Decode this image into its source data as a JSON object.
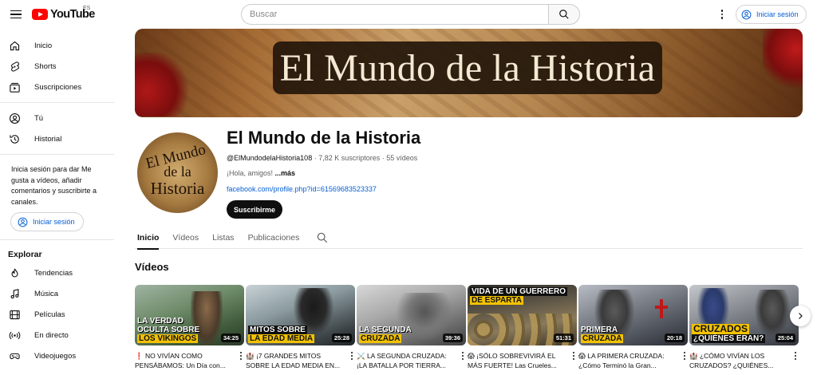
{
  "topbar": {
    "logo_text": "YouTube",
    "region": "ES",
    "search_placeholder": "Buscar",
    "signin_label": "Iniciar sesión"
  },
  "sidebar": {
    "main_items": [
      {
        "label": "Inicio",
        "icon": "home-icon"
      },
      {
        "label": "Shorts",
        "icon": "shorts-icon"
      },
      {
        "label": "Suscripciones",
        "icon": "subscriptions-icon"
      }
    ],
    "you_items": [
      {
        "label": "Tú",
        "icon": "user-icon"
      },
      {
        "label": "Historial",
        "icon": "history-icon"
      }
    ],
    "signin_prompt": "Inicia sesión para dar Me gusta a vídeos, añadir comentarios y suscribirte a canales.",
    "signin_label": "Iniciar sesión",
    "explore_title": "Explorar",
    "explore_items": [
      {
        "label": "Tendencias",
        "icon": "trending-icon"
      },
      {
        "label": "Música",
        "icon": "music-icon"
      },
      {
        "label": "Películas",
        "icon": "movies-icon"
      },
      {
        "label": "En directo",
        "icon": "live-icon"
      },
      {
        "label": "Videojuegos",
        "icon": "gaming-icon"
      }
    ]
  },
  "channel": {
    "banner_title": "El Mundo de la Historia",
    "avatar_lines": [
      "El Mundo",
      "de la",
      "Historia"
    ],
    "name": "El Mundo de la Historia",
    "handle": "@ElMundodelaHistoria108",
    "subscribers": "7,82 K suscriptores",
    "videos_count": "55 vídeos",
    "description": "¡Hola, amigos!",
    "more_label": "...más",
    "link": "facebook.com/profile.php?id=61569683523337",
    "subscribe_label": "Suscribirme"
  },
  "tabs": [
    {
      "label": "Inicio",
      "active": true
    },
    {
      "label": "Vídeos",
      "active": false
    },
    {
      "label": "Listas",
      "active": false
    },
    {
      "label": "Publicaciones",
      "active": false
    }
  ],
  "videos_section": {
    "title": "Vídeos",
    "items": [
      {
        "caption": [
          "La verdad",
          "oculta sobre",
          "los vikingos"
        ],
        "duration": "34:25",
        "title": "❗ NO VIVÍAN COMO PENSÁBAMOS: Un Día con..."
      },
      {
        "caption": [
          "Mitos sobre",
          "la edad media"
        ],
        "duration": "25:28",
        "title": "🏰 ¡7 GRANDES MITOS SOBRE LA EDAD MEDIA EN..."
      },
      {
        "caption": [
          "La segunda",
          "cruzada"
        ],
        "duration": "39:36",
        "title": "⚔️ LA SEGUNDA CRUZADA: ¡LA BATALLA POR TIERRA..."
      },
      {
        "caption": [
          "Vida de un guerrero",
          "de esparta"
        ],
        "duration": "51:31",
        "title": "😱 ¡SÓLO SOBREVIVIRÁ EL MÁS FUERTE! Las Crueles..."
      },
      {
        "caption": [
          "Primera",
          "cruzada"
        ],
        "duration": "20:18",
        "title": "😱 LA PRIMERA CRUZADA: ¿Cómo Terminó la Gran..."
      },
      {
        "caption": [
          "Cruzados",
          "¿quiénes eran?"
        ],
        "duration": "25:04",
        "title": "🏰 ¿CÓMO VIVÍAN LOS CRUZADOS? ¿QUIÉNES..."
      }
    ]
  },
  "colors": {
    "brand_red": "#ff0000",
    "link_blue": "#065fd4",
    "caption_yellow": "#f2c200"
  }
}
